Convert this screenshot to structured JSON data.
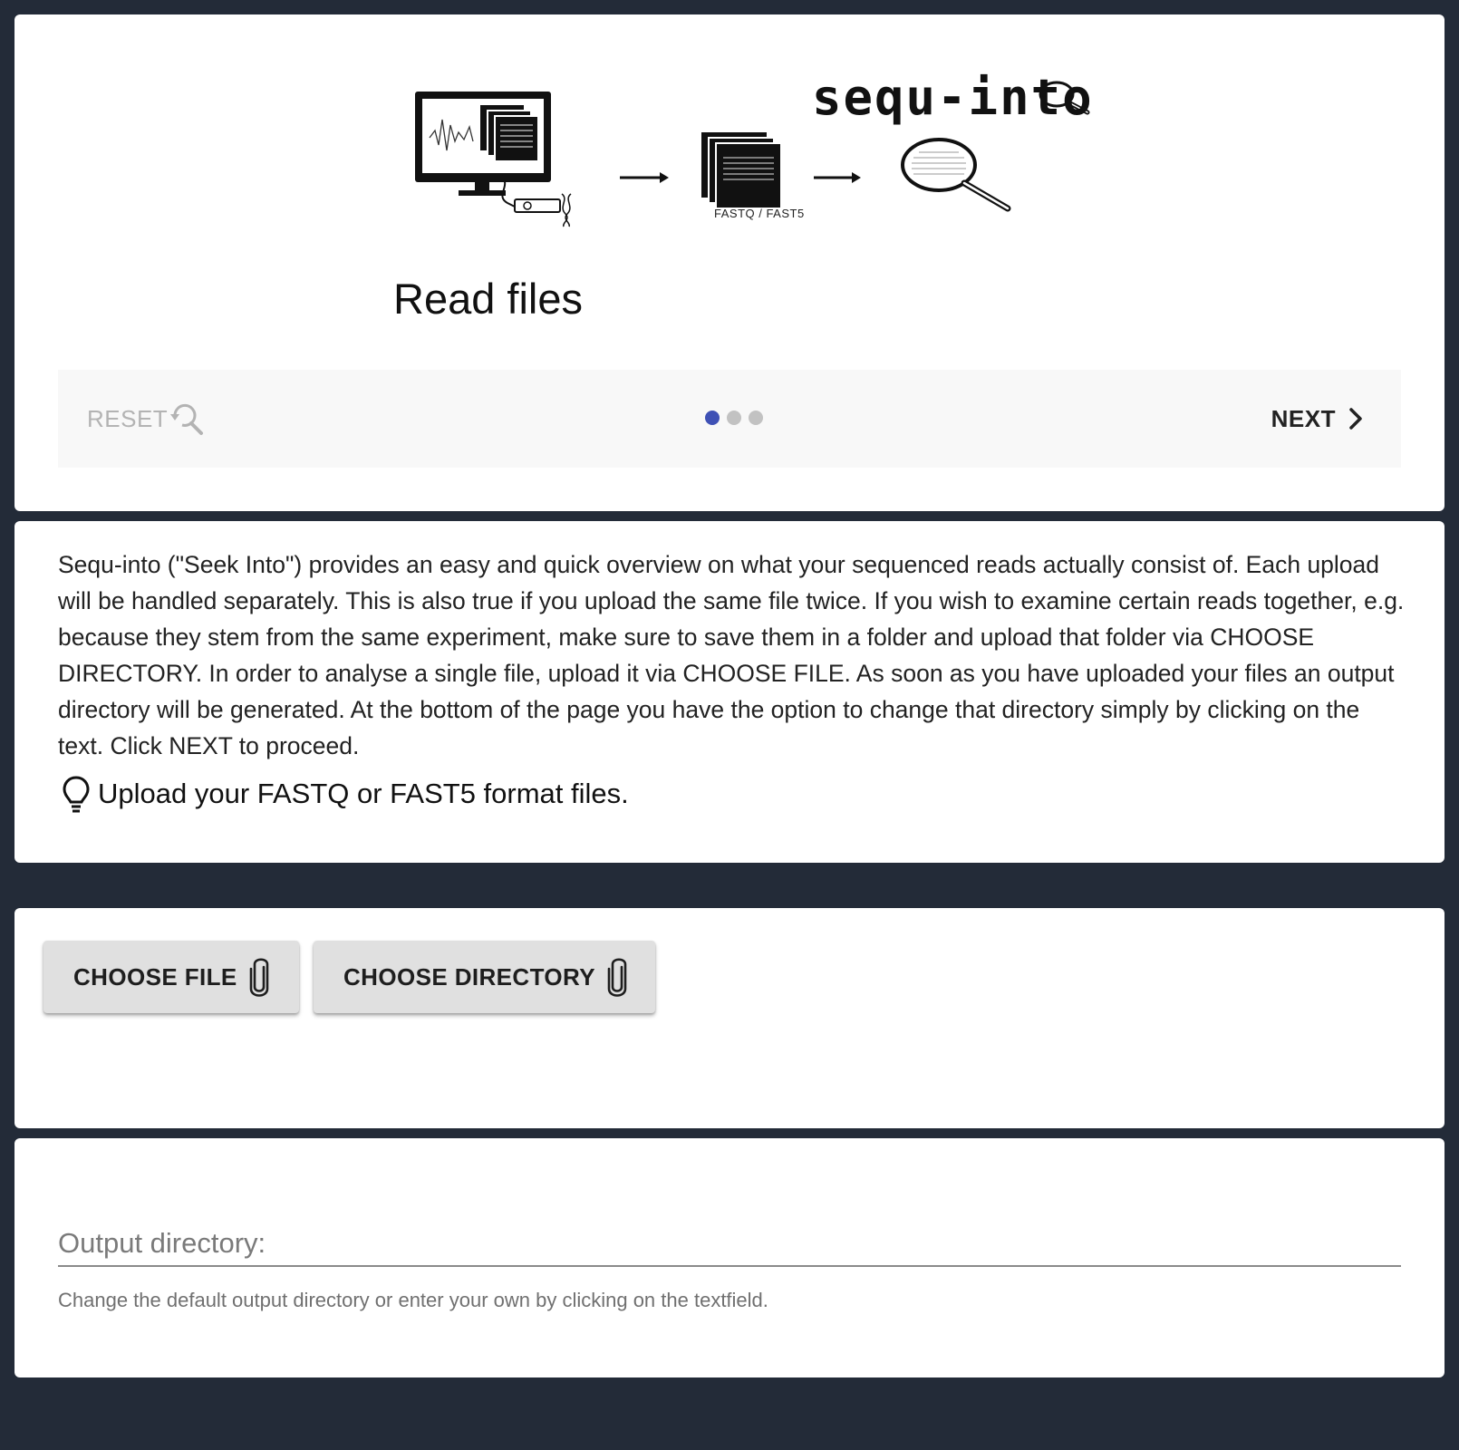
{
  "header": {
    "logo_text": "sequ-into",
    "format_caption": "FASTQ / FAST5",
    "step_title": "Read files"
  },
  "stepper": {
    "reset_label": "RESET",
    "next_label": "NEXT",
    "total_steps": 3,
    "active_step": 1
  },
  "info": {
    "description": "Sequ-into (\"Seek Into\") provides an easy and quick overview on what your sequenced reads actually consist of. Each upload will be handled separately. This is also true if you upload the same file twice. If you wish to examine certain reads together, e.g. because they stem from the same experiment, make sure to save them in a folder and upload that folder via CHOOSE DIRECTORY. In order to analyse a single file, upload it via CHOOSE FILE. As soon as you have uploaded your files an output directory will be generated. At the bottom of the page you have the option to change that directory simply by clicking on the text. Click NEXT to proceed.",
    "hint": "Upload your FASTQ or FAST5 format files."
  },
  "upload": {
    "choose_file_label": "CHOOSE FILE",
    "choose_directory_label": "CHOOSE DIRECTORY"
  },
  "output": {
    "label": "Output directory:",
    "value": "",
    "helper": "Change the default output directory or enter your own by clicking on the textfield."
  },
  "colors": {
    "background": "#232b38",
    "card": "#ffffff",
    "accent": "#3f51b5",
    "button": "#e0e0e0"
  },
  "icons": [
    "monitor-icon",
    "arrow-right-icon",
    "file-stack-icon",
    "magnifier-icon",
    "reset-search-icon",
    "chevron-right-icon",
    "lightbulb-icon",
    "paperclip-icon"
  ]
}
